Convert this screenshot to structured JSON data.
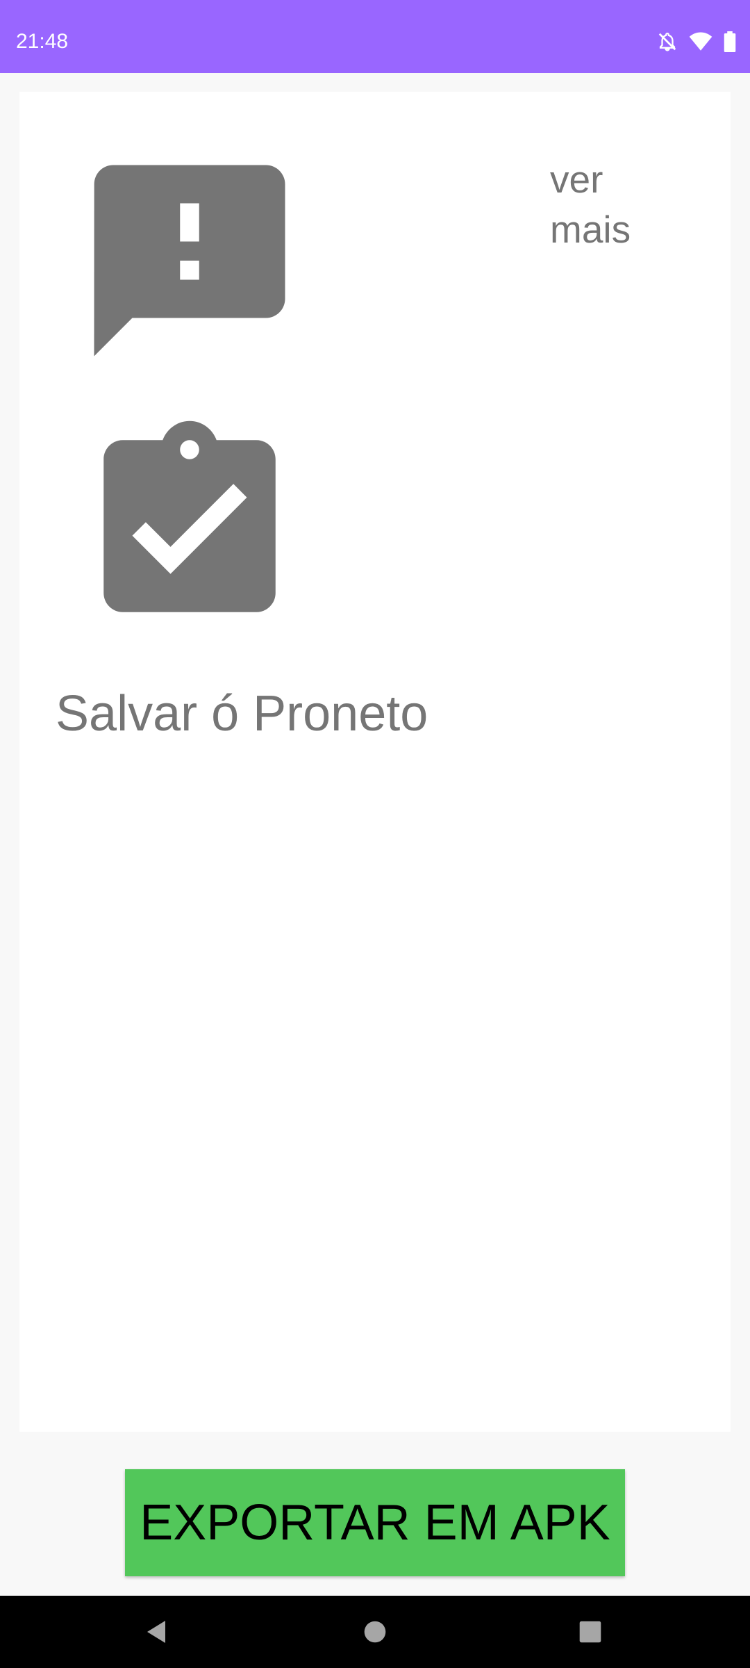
{
  "status_bar": {
    "time": "21:48",
    "background_color": "#9966ff",
    "icons": [
      "notifications-off-icon",
      "wifi-icon",
      "battery-icon"
    ]
  },
  "card": {
    "icons": [
      "feedback-icon",
      "assignment-turned-in-icon"
    ],
    "see_more": {
      "line1": "ver",
      "line2": "mais"
    },
    "save_label": "Salvar ó Proneto"
  },
  "export_button": {
    "label": "EXPORTAR EM APK",
    "color": "#52c75a"
  },
  "nav_bar": {
    "icons": [
      "back-icon",
      "home-icon",
      "recents-icon"
    ]
  }
}
